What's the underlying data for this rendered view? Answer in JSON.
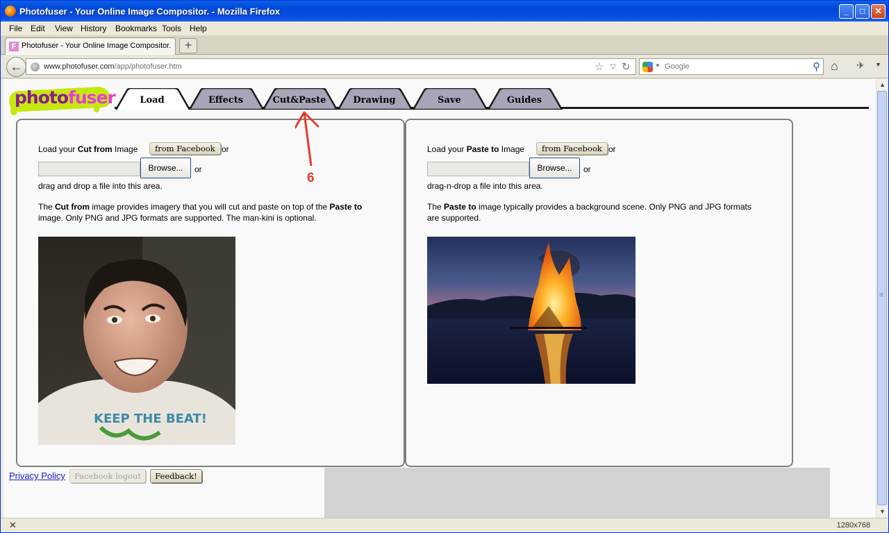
{
  "window": {
    "title": "Photofuser - Your Online Image Compositor. - Mozilla Firefox",
    "minimize_glyph": "_",
    "maximize_glyph": "□",
    "close_glyph": "✕"
  },
  "menu": [
    "File",
    "Edit",
    "View",
    "History",
    "Bookmarks",
    "Tools",
    "Help"
  ],
  "browser_tab": {
    "favicon_letter": "F",
    "label": "Photofuser - Your Online Image Compositor.",
    "new_tab": "+"
  },
  "navbar": {
    "url_host": "www.photofuser.com",
    "url_path": "/app/photofuser.htm",
    "search_placeholder": "Google"
  },
  "logo": {
    "part1": "photo",
    "part2": "fuser"
  },
  "app_tabs": [
    {
      "label": "Load",
      "active": true
    },
    {
      "label": "Effects",
      "active": false
    },
    {
      "label": "Cut&Paste",
      "active": false
    },
    {
      "label": "Drawing",
      "active": false
    },
    {
      "label": "Save",
      "active": false
    },
    {
      "label": "Guides",
      "active": false
    }
  ],
  "cut_panel": {
    "load_prefix": "Load your ",
    "load_bold": "Cut from",
    "load_suffix": " Image",
    "facebook_button": "from Facebook",
    "or1": "or",
    "browse_button": "Browse...",
    "or2": "or",
    "drag_text": "drag and drop a file into this area.",
    "desc_1": "The ",
    "desc_bold1": "Cut from",
    "desc_2": " image provides imagery that you will cut and paste on top of the ",
    "desc_bold2": "Paste to",
    "desc_3": " image. Only PNG and JPG formats are supported. The man-kini is optional.",
    "shirt_text": "KEEP THE BEAT!"
  },
  "paste_panel": {
    "load_prefix": "Load your ",
    "load_bold": "Paste to",
    "load_suffix": " Image",
    "facebook_button": "from Facebook",
    "or1": "or",
    "browse_button": "Browse...",
    "or2": "or",
    "drag_text": "drag-n-drop a file into this area.",
    "desc_1": "The ",
    "desc_bold1": "Paste to",
    "desc_2": " image typically provides a background scene. Only PNG and JPG formats are supported."
  },
  "footer": {
    "privacy": "Privacy Policy",
    "facebook_logout": "Facebook logout",
    "feedback": "Feedback!"
  },
  "annotation": {
    "label": "6",
    "color": "#e6392e"
  },
  "status": {
    "close": "✕",
    "resolution": "1280x768"
  },
  "colors": {
    "logo_purple": "#8a1b8f",
    "logo_pink": "#e23fd6",
    "logo_lime": "#c7e80e",
    "tab_inactive": "#a8a5b9"
  }
}
